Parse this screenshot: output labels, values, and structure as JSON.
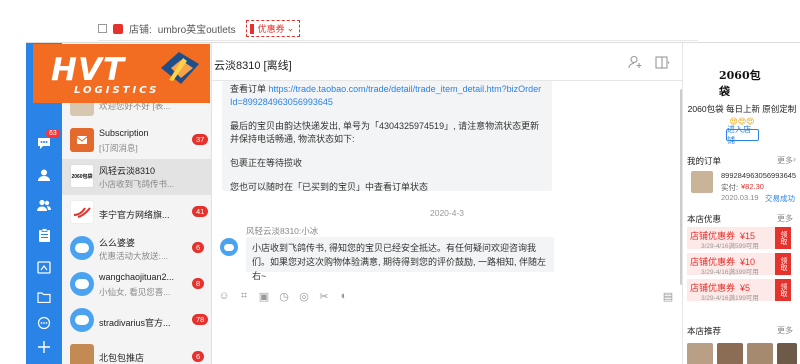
{
  "background_page": {
    "shop_label": "店铺:",
    "shop_name": "umbro英宝outlets",
    "coupon_label": "优惠券",
    "coupon_arrow": "⌄"
  },
  "watermark": {
    "brand": "HVT",
    "tagline": "LOGISTICS"
  },
  "iconbar": {
    "unread_badge": "63",
    "icons": [
      "chat-icon",
      "contact-icon",
      "group-icon",
      "order-icon",
      "shop-icon",
      "file-icon",
      "more-icon",
      "add-icon"
    ]
  },
  "conversations": [
    {
      "title": "",
      "subtitle": "欢迎您好不好 [表...",
      "count": ""
    },
    {
      "title": "Subscription",
      "subtitle": "[订阅消息]",
      "count": "37"
    },
    {
      "title": "风轻云淡8310",
      "subtitle": "小店收到飞鸽传书...",
      "count": "",
      "avatar_text": "2060包袋"
    },
    {
      "title": "李宁官方网络旗...",
      "subtitle": "",
      "count": "41"
    },
    {
      "title": "么么婆婆",
      "subtitle": "优惠活动大放送:...",
      "count": "6"
    },
    {
      "title": "wangchaojituan2...",
      "subtitle": "小仙女, 看见您喜...",
      "count": "8"
    },
    {
      "title": "stradivarius官方...",
      "subtitle": "",
      "count": "78"
    },
    {
      "title": "北包包推店",
      "subtitle": "",
      "count": "6"
    }
  ],
  "chat": {
    "title": "云淡8310 [离线]",
    "message1": {
      "line1_prefix": "查看订单",
      "link_line1": "https://trade.taobao.com/trade/detail/trade_item_detail.htm?bizOrder",
      "link_line2": "Id=899284963056993645",
      "para2": "最后的宝贝由韵达快递发出, 单号为「4304325974519」, 请注意物流状态更新并保持电话畅通, 物流状态如下:",
      "para3": "包裹正在等待揽收",
      "para4": "您也可以随时在「已买到的宝贝」中查看订单状态"
    },
    "date": "2020-4-3",
    "sender": "风轻云淡8310:小冰",
    "message2": "小店收到飞鸽传书, 得知您的宝贝已经安全抵达。有任何疑问欢迎咨询我们。如果您对这次购物体验满意, 期待得到您的评价鼓励, 一路相知, 伴随左右~"
  },
  "side": {
    "logo_text": "2060包袋",
    "shop_desc": "2060包袋 每日上新 原创定制",
    "emojis": "😍😍😍",
    "enter_shop": "进入店铺",
    "orders_title": "我的订单",
    "more": "更多",
    "order": {
      "id": "899284963056993645",
      "paid_label": "实付:",
      "amount": "¥82.30",
      "date": "2020.03.19",
      "status": "交易成功"
    },
    "coupons_title": "本店优惠",
    "coupons": [
      {
        "label": "店铺优惠券",
        "value": "¥15",
        "expiry": "3/29-4/16满599可用",
        "get": "领取"
      },
      {
        "label": "店铺优惠券",
        "value": "¥10",
        "expiry": "3/29-4/16满399可用",
        "get": "领取"
      },
      {
        "label": "店铺优惠券",
        "value": "¥5",
        "expiry": "3/29-4/16满199可用",
        "get": "领取"
      }
    ],
    "recommend_title": "本店推荐"
  },
  "colors": {
    "blue": "#2a83e6",
    "red": "#e5322d",
    "orange": "#f26c22"
  }
}
